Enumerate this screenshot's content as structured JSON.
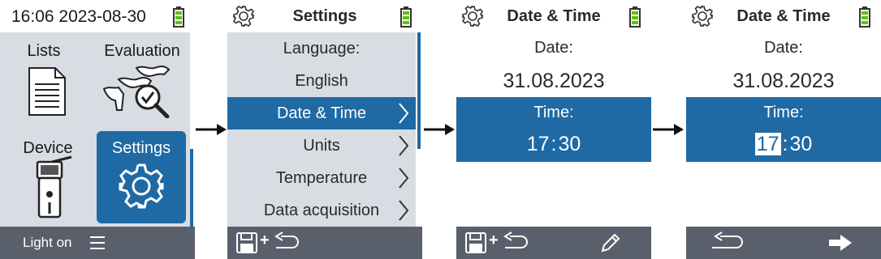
{
  "screen1": {
    "clock": "16:06 2023-08-30",
    "tiles": {
      "lists": "Lists",
      "evaluation": "Evaluation",
      "device": "Device",
      "settings": "Settings"
    },
    "footer_label": "Light on"
  },
  "screen2": {
    "title": "Settings",
    "items": [
      "Language:",
      "English",
      "Date & Time",
      "Units",
      "Temperature",
      "Data acquisition"
    ]
  },
  "screen3": {
    "title": "Date & Time",
    "date_label": "Date:",
    "date_value": "31.08.2023",
    "time_label": "Time:",
    "hour": "17",
    "colon": ":",
    "minute": "30"
  },
  "screen4": {
    "title": "Date & Time",
    "date_label": "Date:",
    "date_value": "31.08.2023",
    "time_label": "Time:",
    "hour": "17",
    "colon": ":",
    "minute": "30"
  },
  "colors": {
    "accent": "#1f6aa5",
    "footer": "#5a5f6c",
    "panel": "#d8dde4",
    "battery": "#5cc300"
  },
  "icons": [
    "gear-icon",
    "battery-icon",
    "menu-icon",
    "save-icon",
    "undo-icon",
    "pencil-icon",
    "arrow-right-icon"
  ]
}
